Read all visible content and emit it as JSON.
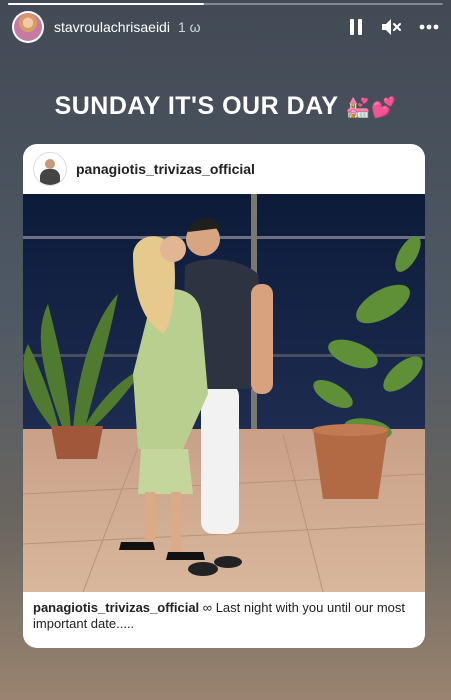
{
  "story": {
    "progress": 0.45,
    "username": "stavroulachrisaeidi",
    "time": "1 ω",
    "text": "SUNDAY IT'S OUR DAY",
    "emoji": "💒💕"
  },
  "icons": {
    "pause": "pause-icon",
    "mute": "speaker-muted-icon",
    "more": "more-horizontal-icon"
  },
  "post": {
    "username": "panagiotis_trivizas_official",
    "caption_user": "panagiotis_trivizas_official",
    "caption_symbol": "∞",
    "caption_text": "Last night with you until our most important date....."
  }
}
